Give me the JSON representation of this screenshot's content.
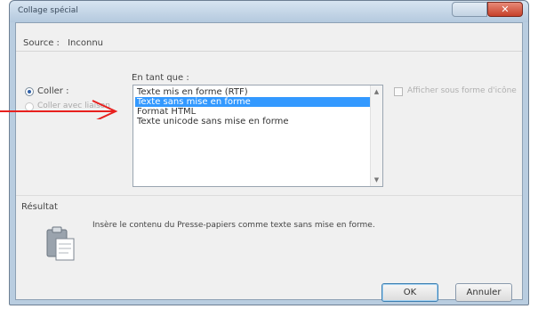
{
  "window": {
    "title": "Collage spécial"
  },
  "source": {
    "label": "Source :",
    "value": "Inconnu"
  },
  "paste_as": {
    "label": "En tant que :",
    "options": [
      "Texte mis en forme (RTF)",
      "Texte sans mise en forme",
      "Format HTML",
      "Texte unicode sans mise en forme"
    ],
    "selected_index": 1
  },
  "modes": {
    "paste_label": "Coller :",
    "paste_link_label": "Coller avec liaison",
    "selected": "paste"
  },
  "icon_option": {
    "label": "Afficher sous forme d'icône",
    "checked": false
  },
  "result": {
    "header": "Résultat",
    "text": "Insère le contenu du Presse-papiers comme texte sans mise en forme."
  },
  "buttons": {
    "ok": "OK",
    "cancel": "Annuler"
  },
  "colors": {
    "accent": "#3399ff",
    "arrow": "#e8201e",
    "close": "#c7412a"
  }
}
